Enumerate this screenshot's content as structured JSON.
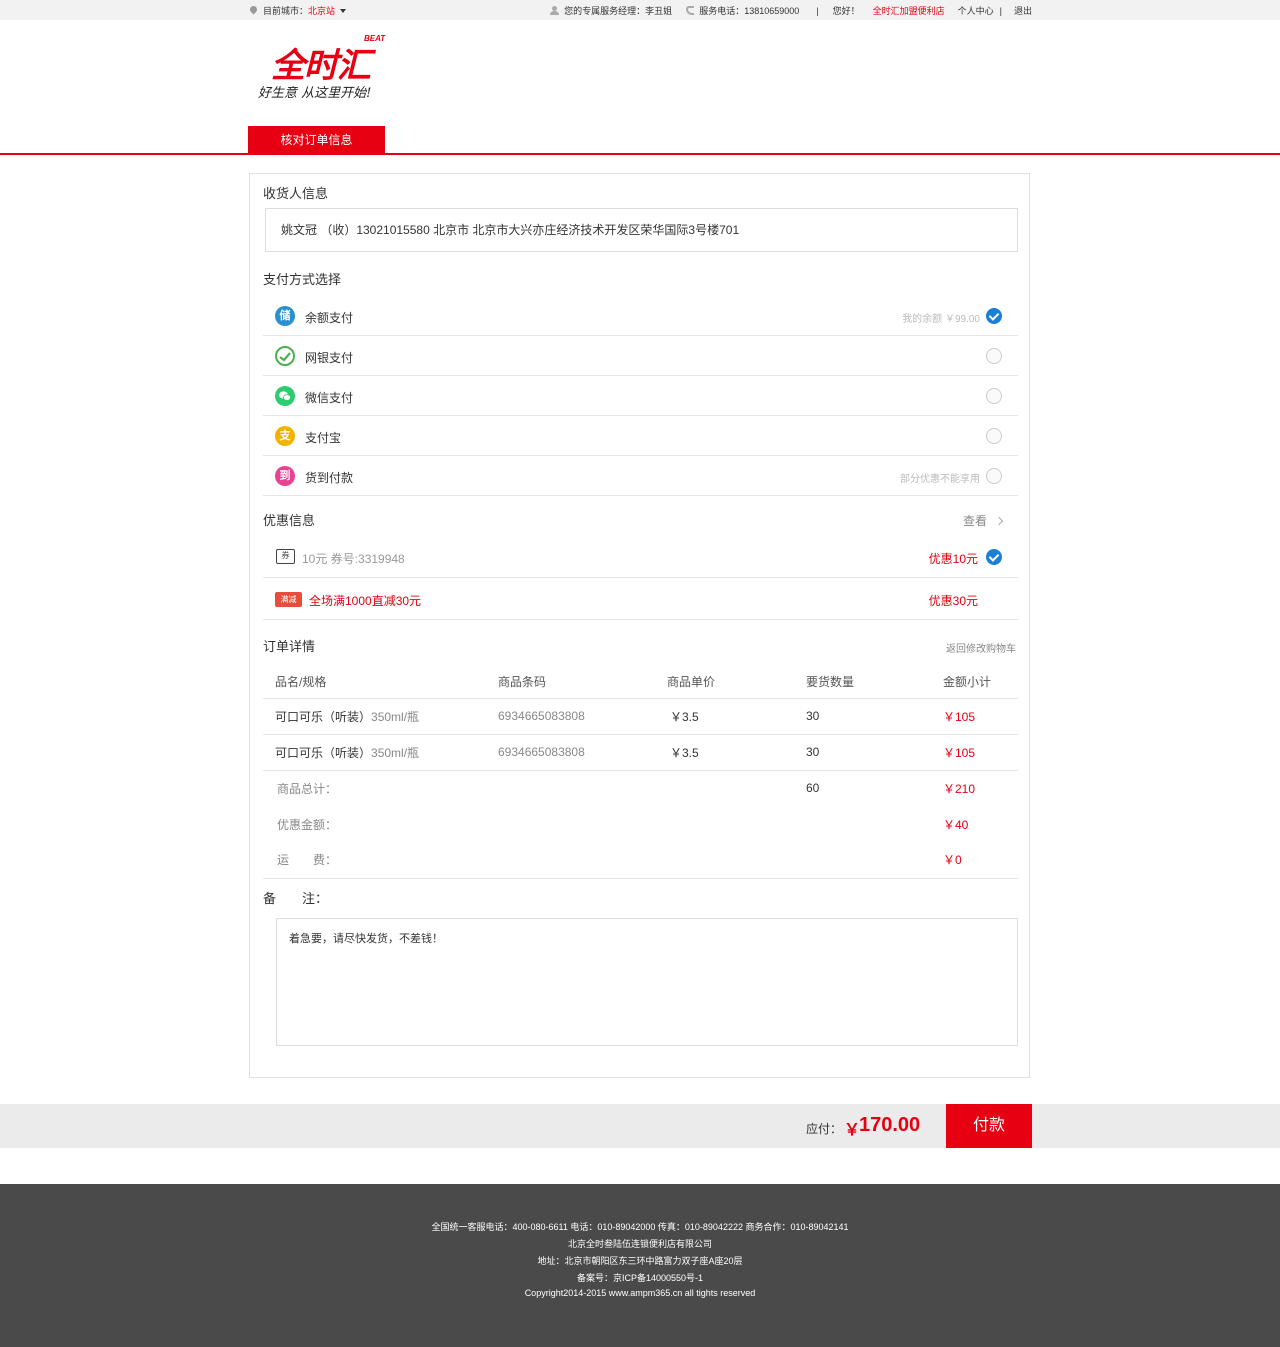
{
  "topbar": {
    "city_label": "目前城市：",
    "city": "北京站",
    "manager": "您的专属服务经理：李丑姐",
    "service_phone": "服务电话：13810659000",
    "sep": "|",
    "hello": "您好！",
    "franchise": "全时汇加盟便利店",
    "user_center": "个人中心",
    "sep2": "|",
    "logout": "退出"
  },
  "logo": {
    "name": "全时汇",
    "beat": "BEAT",
    "slogan": "好生意 从这里开始!"
  },
  "step_tab": "核对订单信息",
  "receiver": {
    "title": "收货人信息",
    "address": "姚文冠 （收）13021015580   北京市  北京市大兴亦庄经济技术开发区荣华国际3号楼701"
  },
  "payment": {
    "title": "支付方式选择",
    "options": [
      {
        "label": "余额支付",
        "icon": "储",
        "note": "我的余额 ￥99.00",
        "selected": true
      },
      {
        "label": "网银支付",
        "icon": "bank-icon",
        "note": "",
        "selected": false
      },
      {
        "label": "微信支付",
        "icon": "wechat-icon",
        "note": "",
        "selected": false
      },
      {
        "label": "支付宝",
        "icon": "支",
        "note": "",
        "selected": false
      },
      {
        "label": "货到付款",
        "icon": "到",
        "note": "部分优惠不能享用",
        "selected": false
      }
    ],
    "colors": {
      "balance": "#2a8fd0",
      "bank": "#4caf50",
      "wechat": "#2ecc71",
      "alipay": "#f0b400",
      "cod": "#e84393"
    }
  },
  "discount": {
    "title": "优惠信息",
    "view": "查看",
    "coupon_icon": "券",
    "coupon": "10元 券号:3319948",
    "coupon_value": "优惠10元",
    "promo_badge": "满减",
    "promo": "全场满1000直减30元",
    "promo_value": "优惠30元"
  },
  "order": {
    "title": "订单详情",
    "back_link": "返回修改购物车",
    "columns": [
      "品名/规格",
      "商品条码",
      "商品单价",
      "要货数量",
      "金额小计"
    ],
    "items": [
      {
        "name": "可口可乐（听装）",
        "spec": "350ml/瓶",
        "barcode": "6934665083808",
        "price": "￥3.5",
        "qty": "30",
        "subtotal": "￥105"
      },
      {
        "name": "可口可乐（听装）",
        "spec": "350ml/瓶",
        "barcode": "6934665083808",
        "price": "￥3.5",
        "qty": "30",
        "subtotal": "￥105"
      }
    ],
    "total_label": "商品总计：",
    "total_qty": "60",
    "total_amount": "￥210",
    "discount_label": "优惠金额：",
    "discount_amount": "￥40",
    "shipping_label": "运　　费：",
    "shipping_amount": "￥0"
  },
  "remark": {
    "label": "备　　注：",
    "text": "着急要，请尽快发货，不差钱！"
  },
  "paybar": {
    "due_label": "应付：",
    "currency": "￥",
    "amount": "170.00",
    "pay_button": "付款"
  },
  "footer": {
    "line1": "全国统一客服电话：400-080-6611  电话：010-89042000  传真：010-89042222   商务合作：010-89042141",
    "line2": "北京全时叁陆伍连锁便利店有限公司",
    "line3": "地址：北京市朝阳区东三环中路富力双子座A座20层",
    "line4": "备案号：京ICP备14000550号-1",
    "line5": "Copyright2014-2015 www.ampm365.cn all tights reserved"
  },
  "theme": {
    "accent": "#e60012",
    "check": "#1a7fd6"
  }
}
